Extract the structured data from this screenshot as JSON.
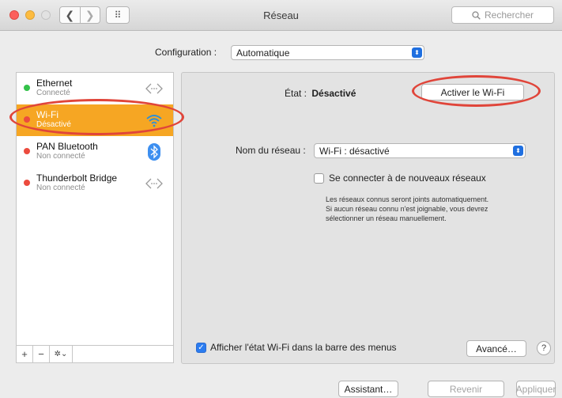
{
  "window": {
    "title": "Réseau"
  },
  "toolbar": {
    "back_glyph": "❮",
    "forward_glyph": "❯",
    "grid_glyph": "⠿",
    "search_placeholder": "Rechercher",
    "search_icon": "magnifier-icon"
  },
  "config": {
    "label": "Configuration :",
    "value": "Automatique"
  },
  "sidebar": {
    "items": [
      {
        "name": "Ethernet",
        "status": "Connecté",
        "dot_color": "#34c24a",
        "icon": "ethernet-arrows-icon",
        "selected": false
      },
      {
        "name": "Wi-Fi",
        "status": "Désactivé",
        "dot_color": "#ec4b3e",
        "icon": "wifi-icon",
        "selected": true
      },
      {
        "name": "PAN Bluetooth",
        "status": "Non connecté",
        "dot_color": "#ec4b3e",
        "icon": "bluetooth-icon",
        "selected": false
      },
      {
        "name": "Thunderbolt Bridge",
        "status": "Non connecté",
        "dot_color": "#ec4b3e",
        "icon": "ethernet-arrows-icon",
        "selected": false
      }
    ],
    "add_glyph": "+",
    "remove_glyph": "−",
    "gear_glyph": "✲⌄"
  },
  "detail": {
    "state_label": "État :",
    "state_value": "Désactivé",
    "toggle_button": "Activer le Wi-Fi",
    "network_label": "Nom du réseau :",
    "network_value": "Wi-Fi : désactivé",
    "join_new_label": "Se connecter à de nouveaux réseaux",
    "join_new_checked": false,
    "help_text_1": "Les réseaux connus seront joints automatiquement.",
    "help_text_2": "Si aucun réseau connu n'est joignable, vous devrez",
    "help_text_3": "sélectionner un réseau manuellement.",
    "show_status_label": "Afficher l'état Wi-Fi dans la barre des menus",
    "show_status_checked": true,
    "advanced_button": "Avancé…",
    "help_glyph": "?"
  },
  "footer": {
    "assistant": "Assistant…",
    "revert": "Revenir",
    "apply": "Appliquer"
  },
  "colors": {
    "selection": "#f6a623",
    "accent": "#2b7cf0",
    "annotation": "#e0453a"
  }
}
